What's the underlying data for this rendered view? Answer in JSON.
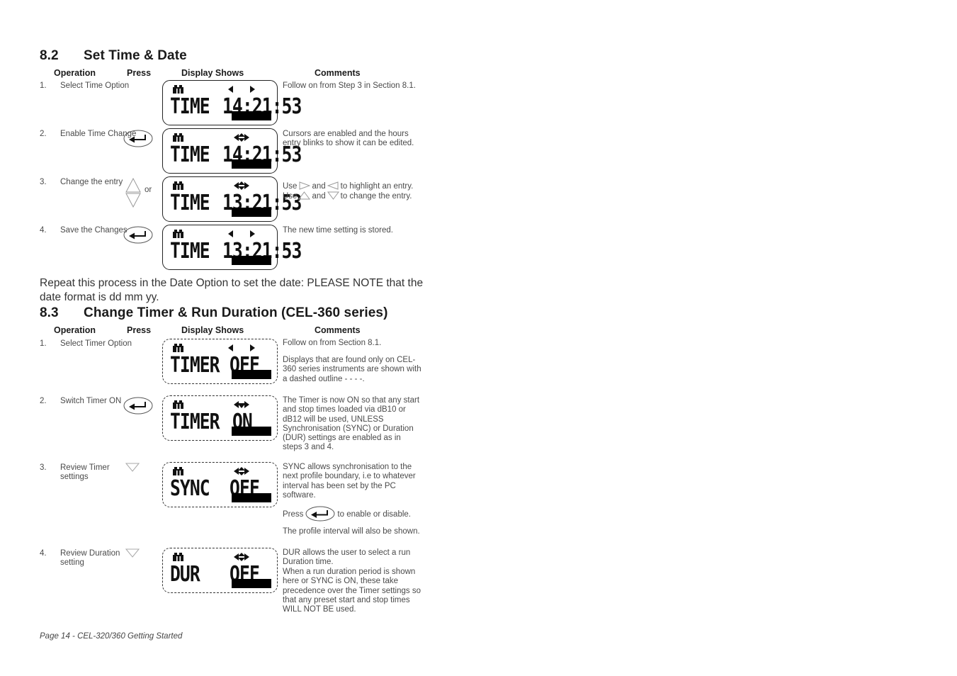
{
  "document": {
    "footer": "Page 14 - CEL-320/360 Getting Started",
    "body_paragraph": "Repeat this process in the Date Option to set the date: PLEASE NOTE that the date format is dd mm yy."
  },
  "column_headers": {
    "operation": "Operation",
    "press": "Press",
    "display": "Display Shows",
    "comments": "Comments"
  },
  "section_82": {
    "number": "8.2",
    "title": "Set Time & Date",
    "steps": [
      {
        "num": "1.",
        "operation": "Select Time Option",
        "press_icon": "none",
        "display": {
          "label": "TIME",
          "value": "14:21:53",
          "arrows": "left-right",
          "battery_icon": "battery-icon",
          "bar": true,
          "dashed": false
        },
        "comment": "Follow on from Step 3 in Section 8.1."
      },
      {
        "num": "2.",
        "operation": "Enable Time Change",
        "press_icon": "enter-key-icon",
        "display": {
          "label": "TIME",
          "value": "14:21:53",
          "arrows": "left-updown-right",
          "battery_icon": "battery-icon",
          "bar": true,
          "dashed": false
        },
        "comment": "Cursors are enabled and the hours entry blinks to show it can be edited."
      },
      {
        "num": "3.",
        "operation": "Change the entry",
        "press_icon": "up-down-triangles-icon",
        "press_extra": "or",
        "display": {
          "label": "TIME",
          "value": "13:21:53",
          "arrows": "left-updown-right",
          "battery_icon": "battery-icon",
          "bar": true,
          "dashed": false
        },
        "comment_part1": "Use",
        "comment_part2": "and",
        "comment_part3": "to highlight an entry.",
        "comment_part4": "Use",
        "comment_part5": "and",
        "comment_part6": "to change the entry."
      },
      {
        "num": "4.",
        "operation": "Save the Changes",
        "press_icon": "enter-key-icon",
        "display": {
          "label": "TIME",
          "value": "13:21:53",
          "arrows": "left-right",
          "battery_icon": "battery-icon",
          "bar": true,
          "dashed": false
        },
        "comment": "The new time setting is stored."
      }
    ]
  },
  "section_83": {
    "number": "8.3",
    "title": "Change Timer & Run Duration (CEL-360 series)",
    "steps": [
      {
        "num": "1.",
        "operation": "Select Timer Option",
        "press_icon": "none",
        "display": {
          "label": "TIMER",
          "value": "OFF",
          "arrows": "left-right",
          "battery_icon": "battery-icon",
          "bar": true,
          "dashed": true
        },
        "comment_a": "Follow on from Section 8.1.",
        "comment_b": "Displays that are found only on CEL-360 series instruments are shown with a dashed outline - - - -."
      },
      {
        "num": "2.",
        "operation": "Switch Timer ON",
        "press_icon": "enter-key-icon",
        "display": {
          "label": "TIMER",
          "value": "ON",
          "arrows": "left-down-right",
          "battery_icon": "battery-icon",
          "bar": true,
          "dashed": true
        },
        "comment": "The Timer is now ON so that any start and stop times loaded via dB10 or dB12 will be used, UNLESS Synchronisation (SYNC) or Duration (DUR) settings are enabled as in steps 3 and 4."
      },
      {
        "num": "3.",
        "operation": "Review Timer settings",
        "press_icon": "down-triangle-icon",
        "display": {
          "label": "SYNC",
          "value": "OFF",
          "arrows": "left-updown-right",
          "battery_icon": "battery-icon",
          "bar": true,
          "dashed": true
        },
        "comment_a": "SYNC allows synchronisation to the next profile boundary, i.e to whatever interval has been set by the PC software.",
        "comment_b_pre": "Press",
        "comment_b_post": "to enable or disable.",
        "comment_c": "The profile interval will also be shown."
      },
      {
        "num": "4.",
        "operation": "Review Duration setting",
        "press_icon": "down-triangle-icon",
        "display": {
          "label": "DUR",
          "value": "OFF",
          "arrows": "left-updown-right",
          "battery_icon": "battery-icon",
          "bar": true,
          "dashed": true
        },
        "comment_a": "DUR allows the user to select a run Duration time.",
        "comment_b": "When a run duration period is shown here or SYNC is ON, these take precedence over the Timer settings so that any preset start and stop times WILL NOT BE used."
      }
    ]
  },
  "colors": {
    "text": "#4a4a4a",
    "heading": "#1a1a1a",
    "lcd_border": "#222222",
    "lcd_bar": "#000000"
  }
}
